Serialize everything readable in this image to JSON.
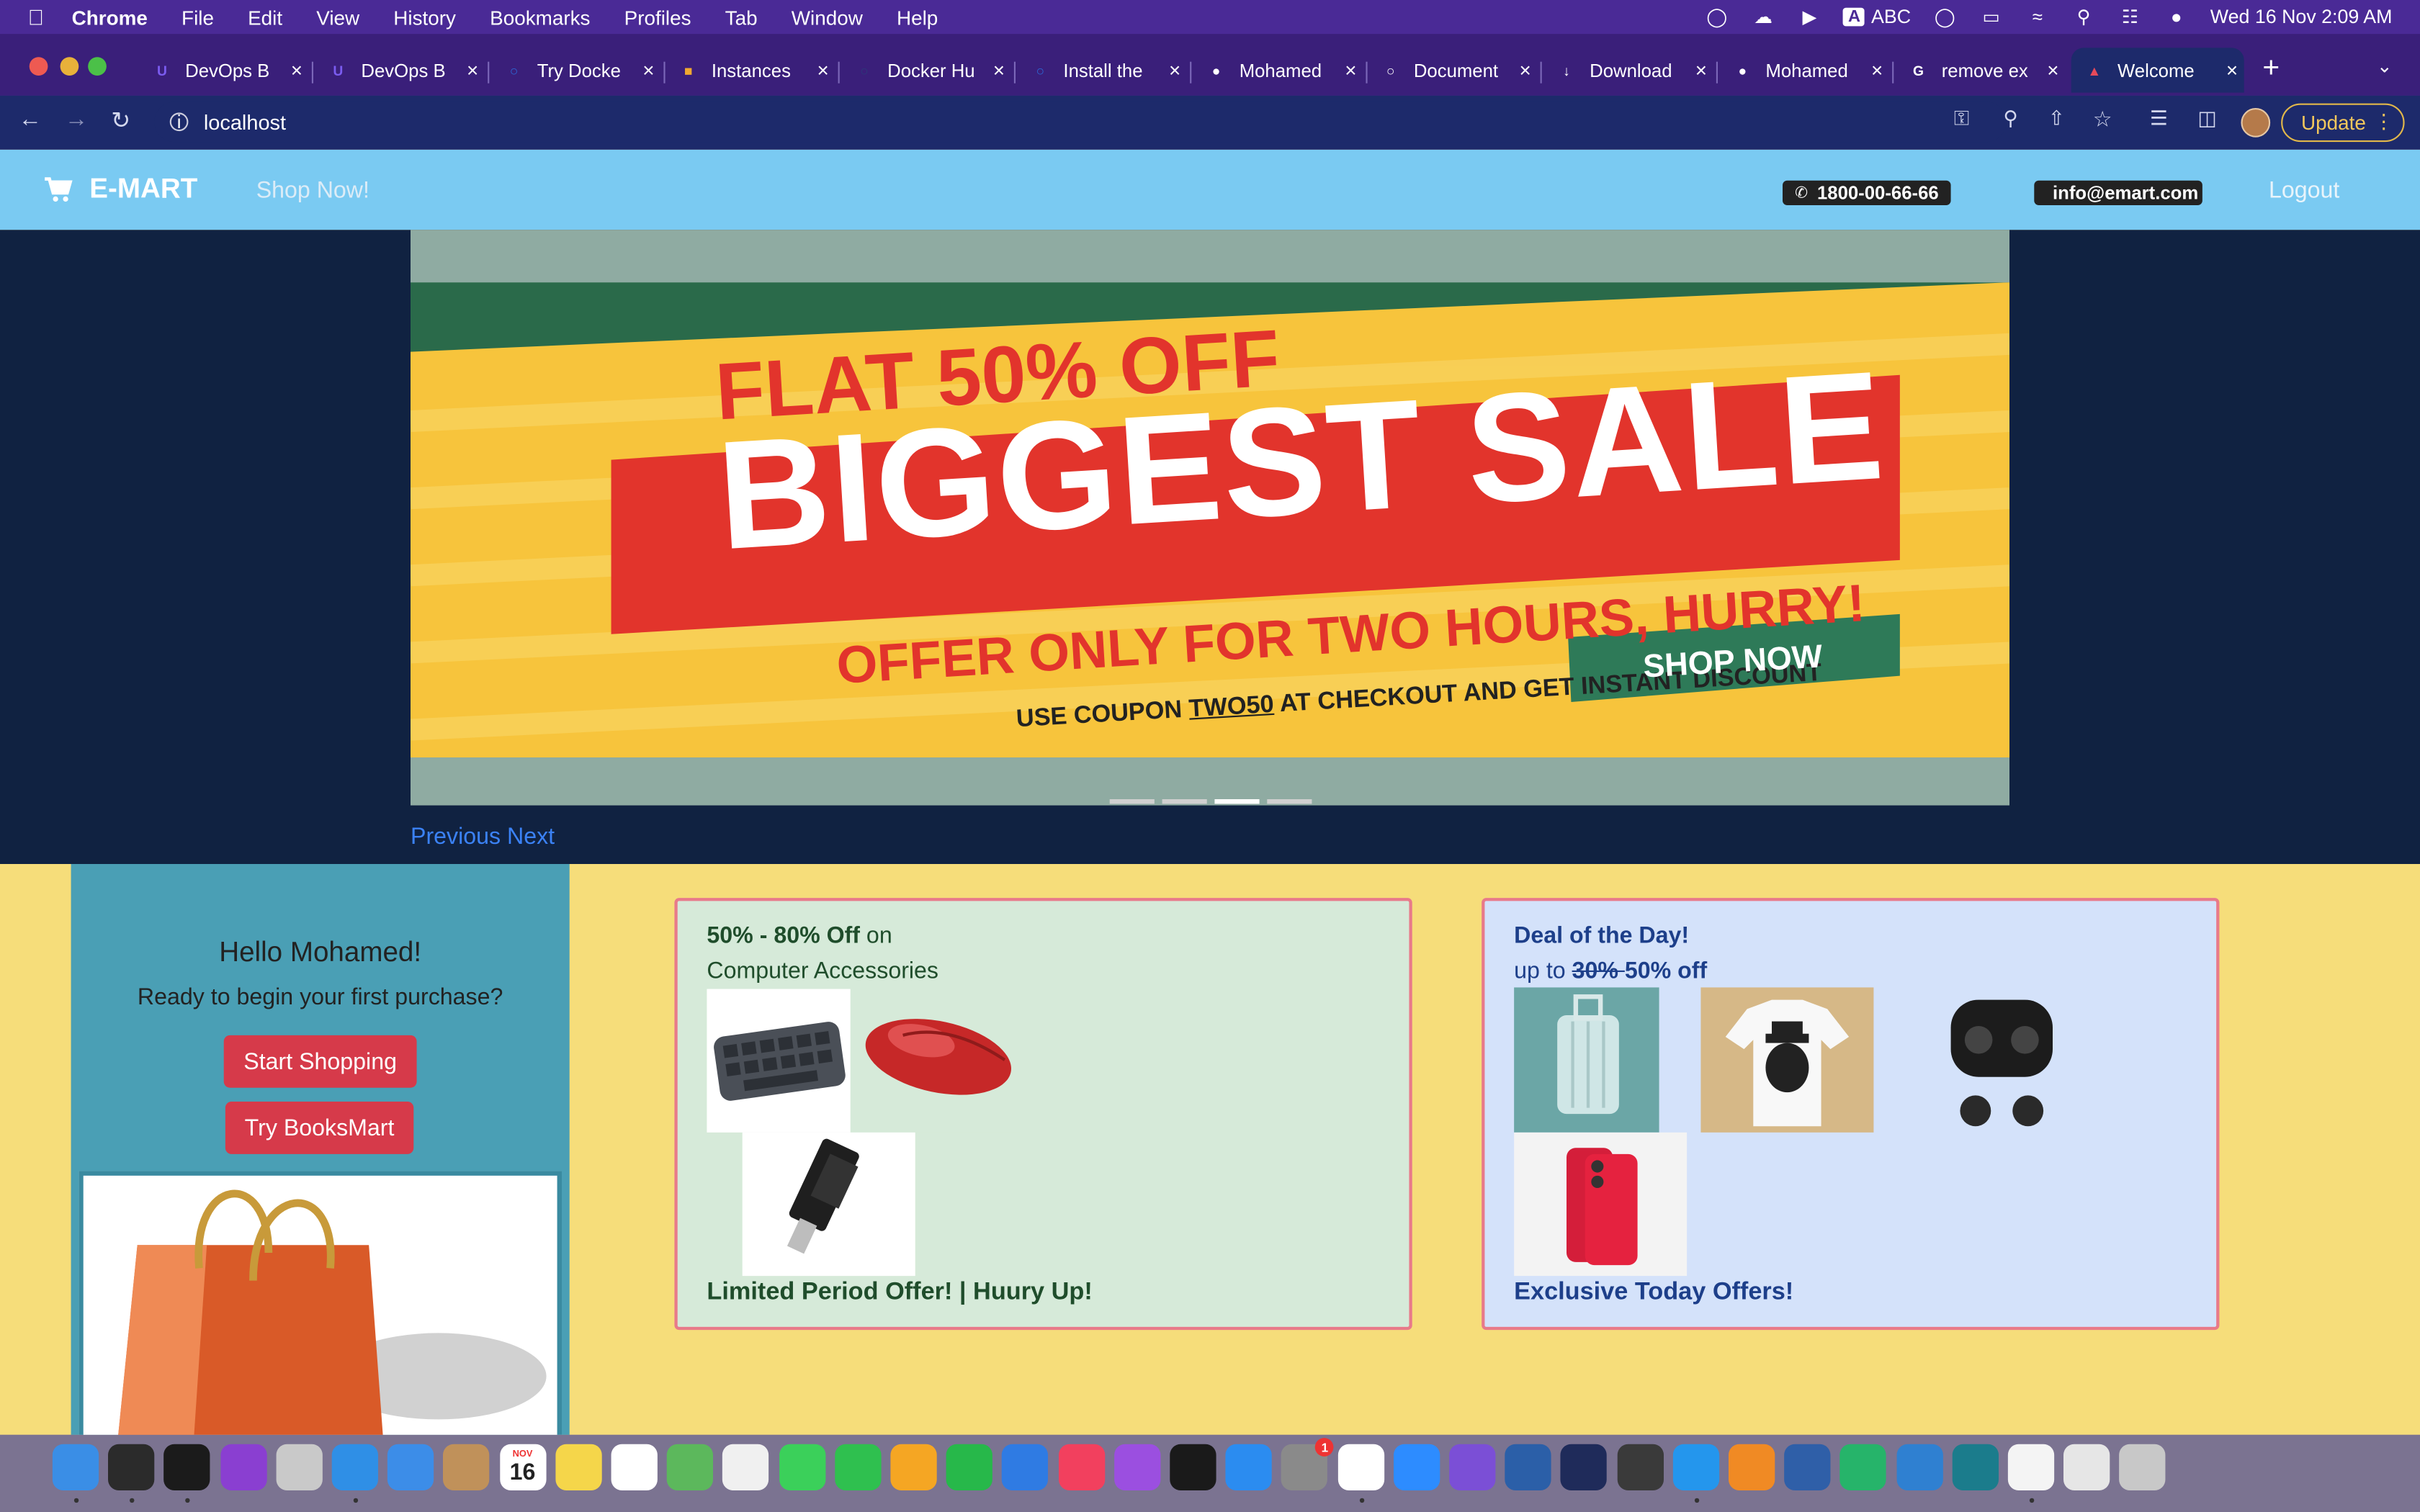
{
  "menubar": {
    "app": "Chrome",
    "items": [
      "File",
      "Edit",
      "View",
      "History",
      "Bookmarks",
      "Profiles",
      "Tab",
      "Window",
      "Help"
    ],
    "input_label": "ABC",
    "clock": "Wed 16 Nov  2:09 AM"
  },
  "tabs": [
    {
      "title": "DevOps B",
      "icon": "devops-icon",
      "color": "#7b5cf0"
    },
    {
      "title": "DevOps B",
      "icon": "devops-icon",
      "color": "#7b5cf0"
    },
    {
      "title": "Try Docke",
      "icon": "docker-icon",
      "color": "#2c6ad9"
    },
    {
      "title": "Instances",
      "icon": "aws-box-icon",
      "color": "#f0a830"
    },
    {
      "title": "Docker Hu",
      "icon": "docker-hub-icon",
      "color": "#2b3a7a"
    },
    {
      "title": "Install the",
      "icon": "docker-icon",
      "color": "#2c6ad9"
    },
    {
      "title": "Mohamed",
      "icon": "github-icon",
      "color": "#ffffff"
    },
    {
      "title": "Document",
      "icon": "globe-icon",
      "color": "#ffffff"
    },
    {
      "title": "Download",
      "icon": "download-icon",
      "color": "#ffffff"
    },
    {
      "title": "Mohamed",
      "icon": "github-icon",
      "color": "#ffffff"
    },
    {
      "title": "remove ex",
      "icon": "google-icon",
      "color": "#ffffff"
    },
    {
      "title": "Welcome",
      "icon": "emart-cart-icon",
      "color": "#e64a5a"
    }
  ],
  "toolbar": {
    "url": "localhost",
    "update_label": "Update"
  },
  "site": {
    "brand": "E-MART",
    "shop_now": "Shop Now!",
    "phone": "1800-00-66-66",
    "email": "info@emart.com",
    "logout": "Logout",
    "carousel": {
      "line1": "FLAT 50% OFF",
      "line2": "BIGGEST SALE",
      "line3": "OFFER ONLY FOR TWO HOURS, HURRY!",
      "line4_pre": "USE COUPON ",
      "coupon": "TWO50",
      "line4_post": " AT CHECKOUT AND GET INSTANT DISCOUNT",
      "cta": "SHOP NOW",
      "prev": "Previous",
      "next": "Next",
      "slide_count": 4,
      "active_slide": 3
    },
    "welcome": {
      "greeting": "Hello Mohamed!",
      "message": "Ready to begin your first purchase?",
      "start": "Start Shopping",
      "books": "Try BooksMart"
    },
    "offer1": {
      "bold": "50% - 80% Off",
      "rest": " on",
      "line2": "Computer Accessories",
      "footer": "Limited Period Offer! | Huury Up!"
    },
    "offer2": {
      "title": "Deal of the Day!",
      "pre": "up to ",
      "strike": "30% ",
      "pct": "50% off",
      "footer": "Exclusive Today Offers!"
    }
  },
  "dock": [
    {
      "name": "finder-icon",
      "color": "#3a8ee6"
    },
    {
      "name": "activity-monitor-icon",
      "color": "#2b2b2b"
    },
    {
      "name": "terminal-icon",
      "color": "#1b1b1b"
    },
    {
      "name": "siri-icon",
      "color": "#8a3fd1"
    },
    {
      "name": "launchpad-icon",
      "color": "#c9c9c9"
    },
    {
      "name": "safari-icon",
      "color": "#2f8fe6"
    },
    {
      "name": "mail-icon",
      "color": "#3c8de8"
    },
    {
      "name": "contacts-icon",
      "color": "#c0915a"
    },
    {
      "name": "calendar-icon",
      "color": "#ffffff"
    },
    {
      "name": "notes-icon",
      "color": "#f5d64a"
    },
    {
      "name": "reminders-icon",
      "color": "#ffffff"
    },
    {
      "name": "maps-icon",
      "color": "#5cb85c"
    },
    {
      "name": "photos-icon",
      "color": "#f0f0f0"
    },
    {
      "name": "messages-icon",
      "color": "#3bd05a"
    },
    {
      "name": "facetime-icon",
      "color": "#2fc04f"
    },
    {
      "name": "pages-icon",
      "color": "#f5a623"
    },
    {
      "name": "numbers-icon",
      "color": "#27b84a"
    },
    {
      "name": "keynote-icon",
      "color": "#2f7be3"
    },
    {
      "name": "music-icon",
      "color": "#f2405e"
    },
    {
      "name": "podcasts-icon",
      "color": "#9b4fe0"
    },
    {
      "name": "apple-tv-icon",
      "color": "#1a1a1a"
    },
    {
      "name": "app-store-icon",
      "color": "#2b8cf0"
    },
    {
      "name": "system-preferences-icon",
      "color": "#8a8a8a"
    },
    {
      "name": "chrome-icon",
      "color": "#ffffff"
    },
    {
      "name": "zoom-icon",
      "color": "#2d8cff"
    },
    {
      "name": "github-desktop-icon",
      "color": "#7b4fd6"
    },
    {
      "name": "sourcetree-icon",
      "color": "#2b5fa8"
    },
    {
      "name": "intellij-icon",
      "color": "#1f2b5a"
    },
    {
      "name": "keychain-icon",
      "color": "#3a3a3a"
    },
    {
      "name": "docker-icon",
      "color": "#2496ed"
    },
    {
      "name": "sublime-icon",
      "color": "#f08a24"
    },
    {
      "name": "virtualbox-icon",
      "color": "#2f5fa8"
    },
    {
      "name": "pycharm-icon",
      "color": "#26b46a"
    },
    {
      "name": "vscode-icon",
      "color": "#2f80d1"
    },
    {
      "name": "arc-icon",
      "color": "#1b7c8c"
    },
    {
      "name": "textedit-icon",
      "color": "#f4f4f4"
    },
    {
      "name": "downloads-stack-icon",
      "color": "#e6e6e6"
    },
    {
      "name": "trash-icon",
      "color": "#c8c8c8"
    }
  ],
  "calendar_tile": {
    "month": "NOV",
    "day": "16"
  },
  "badge_count": "1"
}
